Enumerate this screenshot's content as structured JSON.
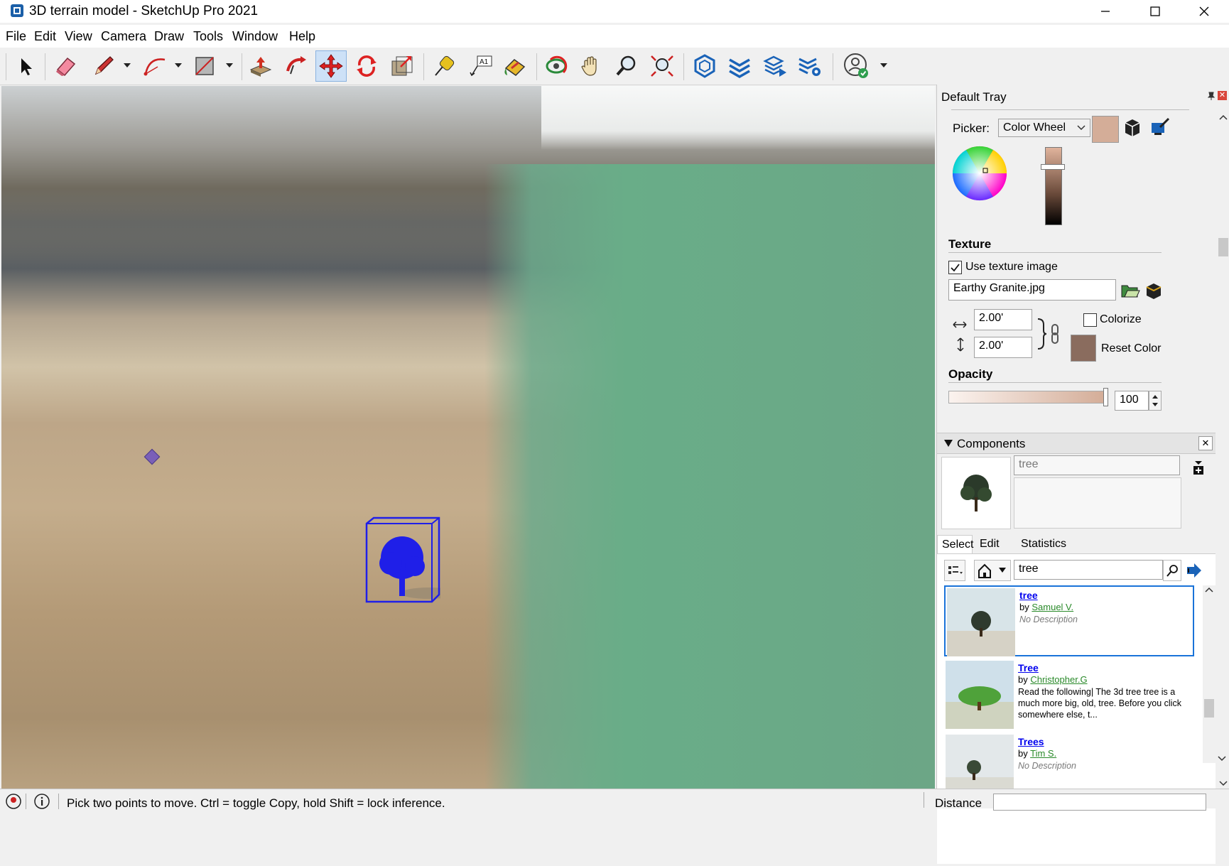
{
  "window": {
    "title": "3D terrain model - SketchUp Pro 2021"
  },
  "menu": [
    "File",
    "Edit",
    "View",
    "Camera",
    "Draw",
    "Tools",
    "Window",
    "Help"
  ],
  "toolbar": {
    "tools": [
      "select-icon",
      "eraser-icon",
      "pencil-icon",
      "arc-icon",
      "rectangle-icon",
      "push-pull-icon",
      "follow-me-icon",
      "move-icon",
      "rotate-icon",
      "scale-icon",
      "tape-measure-icon",
      "text-icon",
      "paint-bucket-icon",
      "orbit-icon",
      "pan-icon",
      "zoom-icon",
      "zoom-extents-icon",
      "3d-warehouse-icon",
      "extension-warehouse-icon",
      "layout-icon",
      "extension-manager-icon",
      "account-icon"
    ],
    "active_tool": "move-icon"
  },
  "tray": {
    "title": "Default Tray",
    "materials": {
      "picker_label": "Picker:",
      "picker_value": "Color Wheel",
      "texture_heading": "Texture",
      "use_texture_label": "Use texture image",
      "use_texture_checked": true,
      "texture_file": "Earthy Granite.jpg",
      "width_value": "2.00'",
      "height_value": "2.00'",
      "colorize_label": "Colorize",
      "colorize_checked": false,
      "reset_color_label": "Reset Color",
      "opacity_heading": "Opacity",
      "opacity_value": "100",
      "swatch_color": "#d4ad98",
      "reset_swatch_color": "#8a6c5e"
    },
    "components": {
      "title": "Components",
      "name_value": "tree",
      "tabs": [
        "Select",
        "Edit",
        "Statistics"
      ],
      "search_value": "tree",
      "results": [
        {
          "name": "tree",
          "by": "by",
          "author": "Samuel V.",
          "desc": "No Description",
          "italic": true
        },
        {
          "name": "Tree",
          "by": "by",
          "author": "Christopher.G",
          "desc": "Read the following| The 3d tree tree is a much more big, old, tree. Before you click somewhere else, t...",
          "italic": false
        },
        {
          "name": "Trees",
          "by": "by",
          "author": "Tim S.",
          "desc": "No Description",
          "italic": true
        }
      ]
    }
  },
  "status": {
    "message": "Pick two points to move.  Ctrl = toggle Copy, hold Shift = lock inference.",
    "measure_label": "Distance",
    "measure_value": ""
  },
  "colors": {
    "selection": "#1f1fe8",
    "accent": "#1a73d9"
  }
}
